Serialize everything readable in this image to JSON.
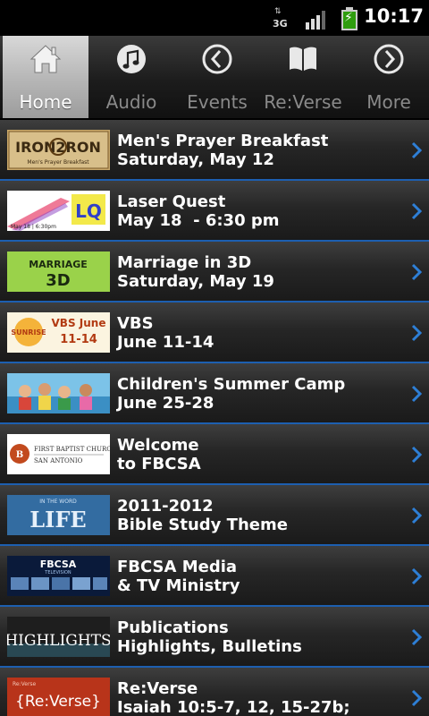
{
  "status_bar": {
    "network_type": "3G",
    "network_arrows": "⇅",
    "time": "10:17",
    "battery_charging": true
  },
  "tabs": [
    {
      "label": "Home",
      "icon": "home-icon",
      "active": true
    },
    {
      "label": "Audio",
      "icon": "music-note-icon",
      "active": false
    },
    {
      "label": "Events",
      "icon": "clock-icon",
      "active": false
    },
    {
      "label": "Re:Verse",
      "icon": "book-icon",
      "active": false
    },
    {
      "label": "More",
      "icon": "more-chevron-icon",
      "active": false
    }
  ],
  "list": [
    {
      "title": "Men's Prayer Breakfast",
      "subtitle": "Saturday, May 12",
      "thumb_text": "IRON2RON",
      "thumb_caption": "Men's Prayer Breakfast"
    },
    {
      "title": "Laser Quest",
      "subtitle": "May 18  - 6:30 pm",
      "thumb_text": "LQ",
      "thumb_caption": "May 18 | 6:30pm"
    },
    {
      "title": "Marriage in 3D",
      "subtitle": "Saturday, May 19",
      "thumb_text": "MARRIAGE 3D",
      "thumb_caption": ""
    },
    {
      "title": "VBS",
      "subtitle": "June 11-14",
      "thumb_text": "VBS June 11-14",
      "thumb_caption": "SUNRISE"
    },
    {
      "title": "Children's Summer Camp",
      "subtitle": "June 25-28",
      "thumb_text": "",
      "thumb_caption": ""
    },
    {
      "title": "Welcome",
      "subtitle": "to FBCSA",
      "thumb_text": "FIRST BAPTIST CHURCH",
      "thumb_caption": "SAN ANTONIO"
    },
    {
      "title": "2011-2012",
      "subtitle": "Bible Study Theme",
      "thumb_text": "LIFE",
      "thumb_caption": "IN THE WORD"
    },
    {
      "title": "FBCSA Media",
      "subtitle": "& TV Ministry",
      "thumb_text": "FBCSA",
      "thumb_caption": "TELEVISION"
    },
    {
      "title": "Publications",
      "subtitle": "Highlights, Bulletins",
      "thumb_text": "HIGHLIGHTS",
      "thumb_caption": ""
    },
    {
      "title": "Re:Verse",
      "subtitle": "Isaiah 10:5-7, 12, 15-27b;",
      "thumb_text": "{Re:Verse}",
      "thumb_caption": "Re:Verse"
    }
  ],
  "colors": {
    "accent_blue": "#1d5fb0",
    "chevron_blue": "#2e7fd6",
    "active_tab": "#b8b8b8"
  }
}
